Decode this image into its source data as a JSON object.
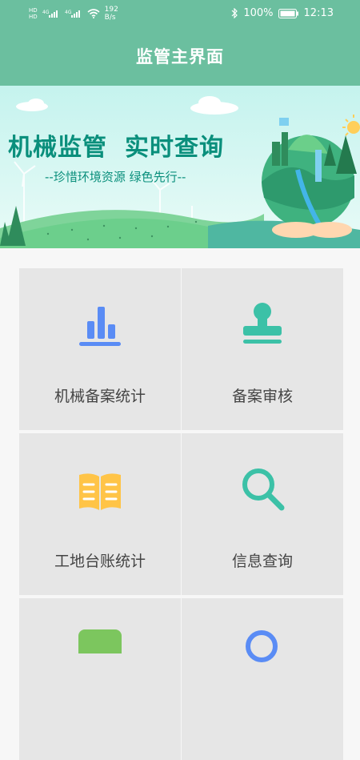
{
  "status_bar": {
    "left_tags": [
      "HD",
      "4G",
      "4G"
    ],
    "net_speed_value": "192",
    "net_speed_unit": "B/s",
    "battery": "100%",
    "time": "12:13",
    "icons": [
      "signal-icon",
      "wifi-icon",
      "bluetooth-icon",
      "battery-icon"
    ]
  },
  "app_bar": {
    "title": "监管主界面"
  },
  "banner": {
    "headline_part1": "机械监管",
    "headline_part2": "实时查询",
    "slogan": "--珍惜环境资源 绿色先行--"
  },
  "menu": {
    "items": [
      {
        "label": "机械备案统计",
        "icon": "bar-chart-icon",
        "color": "#5a8cf5"
      },
      {
        "label": "备案审核",
        "icon": "stamp-icon",
        "color": "#3cc1a7"
      },
      {
        "label": "工地台账统计",
        "icon": "book-icon",
        "color": "#ffc447"
      },
      {
        "label": "信息查询",
        "icon": "search-icon",
        "color": "#3cc1a7"
      },
      {
        "label": "",
        "icon": "green-tile-icon",
        "color": "#7cc65e"
      },
      {
        "label": "",
        "icon": "location-icon",
        "color": "#5a8cf5"
      }
    ]
  },
  "colors": {
    "primary": "#6bbf9f",
    "banner_text": "#0a8f7c",
    "tile_bg": "#e6e6e6"
  }
}
